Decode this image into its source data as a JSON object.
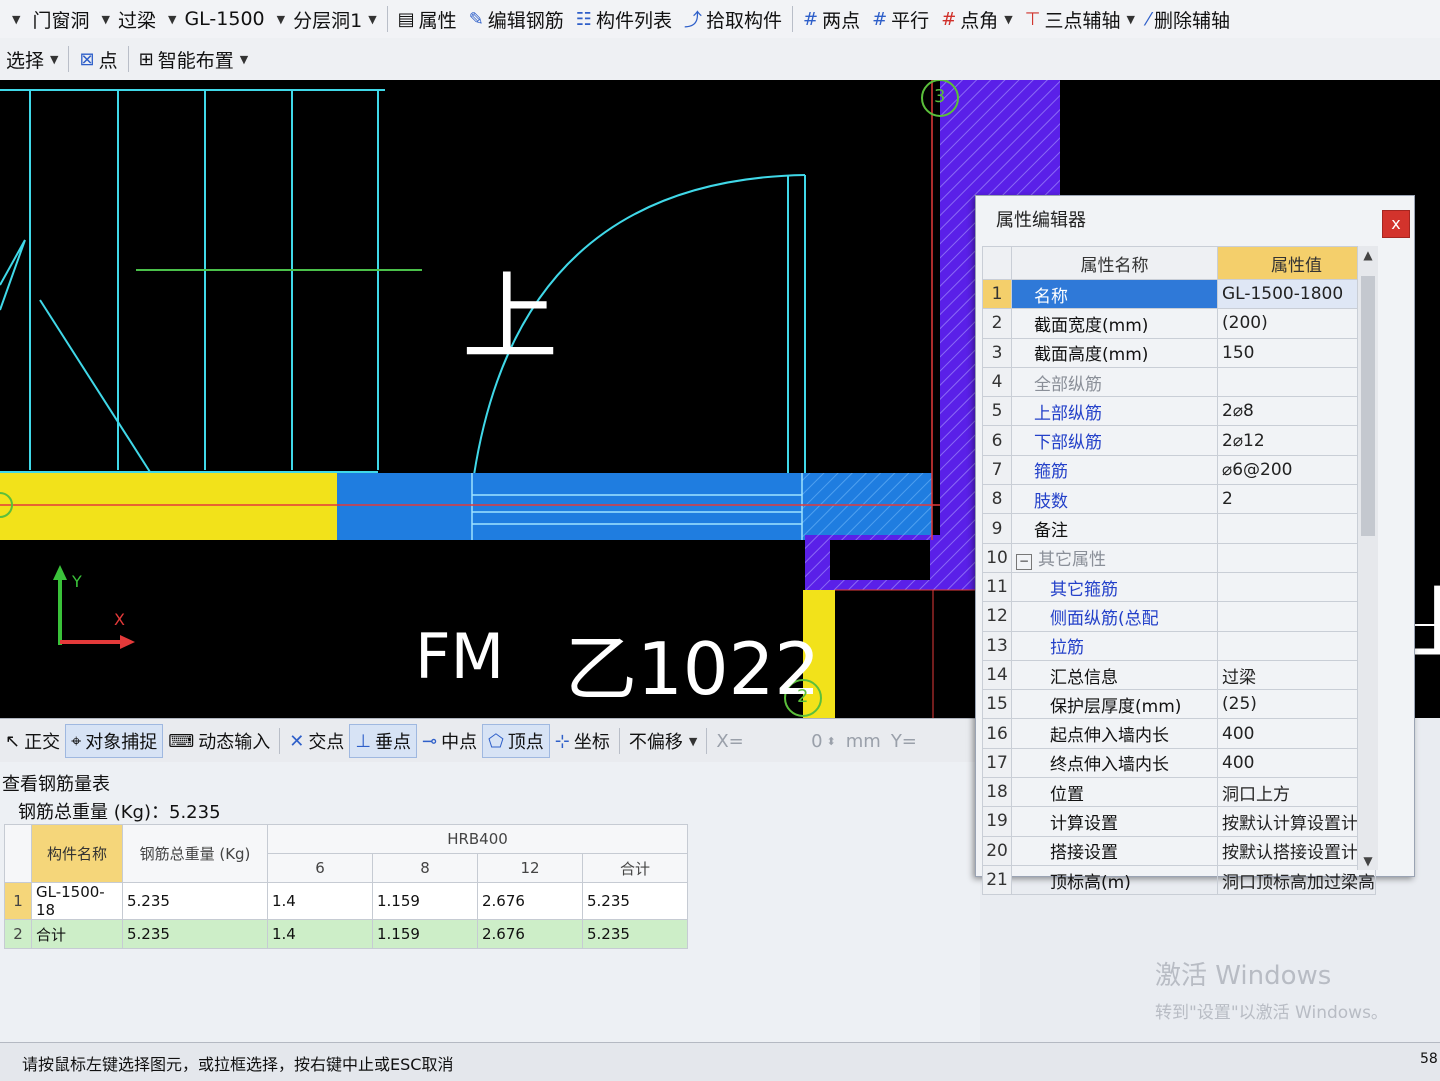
{
  "toolbar1": {
    "items": [
      "",
      "门窗洞",
      "过梁",
      "GL-1500",
      "分层洞1",
      "属性",
      "编辑钢筋",
      "构件列表",
      "拾取构件",
      "两点",
      "平行",
      "点角",
      "三点辅轴",
      "删除辅轴"
    ]
  },
  "toolbar2": {
    "select": "选择",
    "point": "点",
    "smart": "智能布置"
  },
  "canvas": {
    "text_up": "上",
    "text_fm": "FM",
    "text_code": "乙1022",
    "axis_y": "Y",
    "axis_x": "X",
    "axis_label_3": "3",
    "axis_label_2": "2",
    "text_right_up": "上"
  },
  "snapbar": {
    "ortho": "正交",
    "osnap": "对象捕捉",
    "dyninput": "动态输入",
    "intersect": "交点",
    "perp": "垂点",
    "mid": "中点",
    "vertex": "顶点",
    "coord": "坐标",
    "offset": "不偏移",
    "x_label": "X=",
    "x_value": "0",
    "unit": "mm",
    "y_label": "Y="
  },
  "rebar": {
    "title": "查看钢筋量表",
    "total": "钢筋总重量 (Kg)：5.235",
    "headers": {
      "name": "构件名称",
      "weight": "钢筋总重量 (Kg)",
      "grade": "HRB400",
      "d6": "6",
      "d8": "8",
      "d12": "12",
      "sum": "合计"
    },
    "rows": [
      {
        "n": "1",
        "name": "GL-1500-18",
        "weight": "5.235",
        "d6": "1.4",
        "d8": "1.159",
        "d12": "2.676",
        "sum": "5.235"
      },
      {
        "n": "2",
        "name": "合计",
        "weight": "5.235",
        "d6": "1.4",
        "d8": "1.159",
        "d12": "2.676",
        "sum": "5.235"
      }
    ]
  },
  "props": {
    "title": "属性编辑器",
    "close": "x",
    "col_name": "属性名称",
    "col_value": "属性值",
    "rows": [
      {
        "n": "1",
        "k": "名称",
        "v": "GL-1500-1800"
      },
      {
        "n": "2",
        "k": "截面宽度(mm)",
        "v": "(200)"
      },
      {
        "n": "3",
        "k": "截面高度(mm)",
        "v": "150"
      },
      {
        "n": "4",
        "k": "全部纵筋",
        "v": ""
      },
      {
        "n": "5",
        "k": "上部纵筋",
        "v": "2⌀8"
      },
      {
        "n": "6",
        "k": "下部纵筋",
        "v": "2⌀12"
      },
      {
        "n": "7",
        "k": "箍筋",
        "v": "⌀6@200"
      },
      {
        "n": "8",
        "k": "肢数",
        "v": "2"
      },
      {
        "n": "9",
        "k": "备注",
        "v": ""
      },
      {
        "n": "10",
        "k": "其它属性",
        "v": ""
      },
      {
        "n": "11",
        "k": "其它箍筋",
        "v": ""
      },
      {
        "n": "12",
        "k": "侧面纵筋(总配",
        "v": ""
      },
      {
        "n": "13",
        "k": "拉筋",
        "v": ""
      },
      {
        "n": "14",
        "k": "汇总信息",
        "v": "过梁"
      },
      {
        "n": "15",
        "k": "保护层厚度(mm)",
        "v": "(25)"
      },
      {
        "n": "16",
        "k": "起点伸入墙内长",
        "v": "400"
      },
      {
        "n": "17",
        "k": "终点伸入墙内长",
        "v": "400"
      },
      {
        "n": "18",
        "k": "位置",
        "v": "洞口上方"
      },
      {
        "n": "19",
        "k": "计算设置",
        "v": "按默认计算设置计算"
      },
      {
        "n": "20",
        "k": "搭接设置",
        "v": "按默认搭接设置计算"
      },
      {
        "n": "21",
        "k": "顶标高(m)",
        "v": "洞口顶标高加过梁高"
      }
    ]
  },
  "status": {
    "text": "请按鼠标左键选择图元，或拉框选择，按右键中止或ESC取消",
    "right": "58"
  },
  "watermark": {
    "line1": "激活 Windows",
    "line2": "转到\"设置\"以激活 Windows。"
  },
  "colors": {
    "beam_yellow": "#f2e21a",
    "beam_blue": "#1f7de0",
    "wall_purple": "#5a20e8",
    "line_cyan": "#40d8e8",
    "selected_blue": "#2f79d8",
    "header_gold": "#f4cf6b"
  }
}
